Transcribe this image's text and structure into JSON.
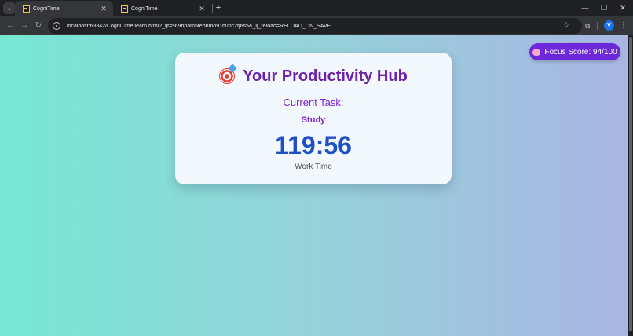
{
  "browser": {
    "tabs": [
      {
        "title": "CogniTime",
        "active": true
      },
      {
        "title": "CogniTime",
        "active": false
      }
    ],
    "tab_close_glyph": "✕",
    "new_tab_glyph": "+",
    "window_controls": {
      "minimize": "—",
      "restore": "❐",
      "close": "✕"
    },
    "url": "localhost:63342/CogniTime/learn.html?_ijt=s69hpam5tebnmo91bupc2tj6s5&_ij_reload=RELOAD_ON_SAVE",
    "profile_initial": "V",
    "icons": [
      "tab-search-icon",
      "back-icon",
      "forward-icon",
      "reload-icon",
      "site-info-icon",
      "bookmark-star-icon",
      "extensions-icon",
      "menu-icon"
    ]
  },
  "page": {
    "focus_badge": {
      "label": "Focus Score: 94/100",
      "color": "#6d28d9"
    },
    "card": {
      "title": "Your Productivity Hub",
      "current_task_label": "Current Task:",
      "task_name": "Study",
      "timer": "119:56",
      "mode": "Work Time"
    },
    "colors": {
      "title": "#6b21a8",
      "task": "#7e22ce",
      "timer": "#1f4fc4",
      "gradient_start": "#76e7d3",
      "gradient_end": "#a9b6e3"
    }
  }
}
